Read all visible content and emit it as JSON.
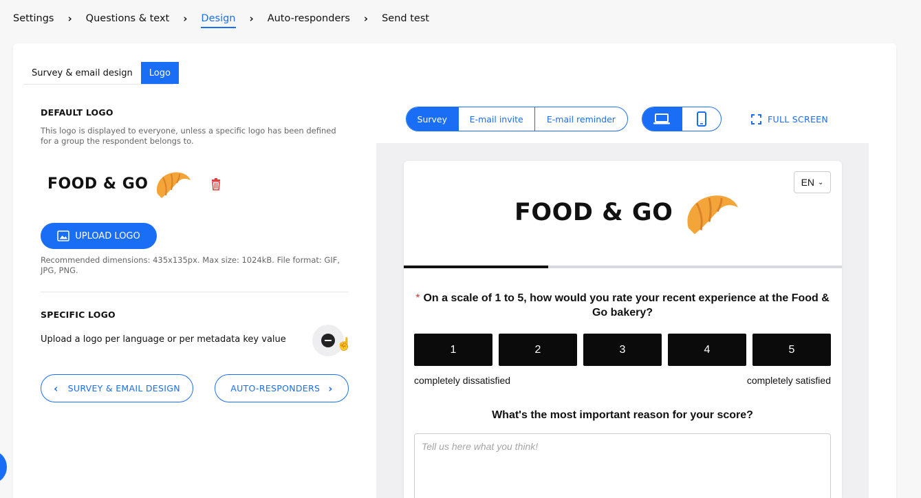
{
  "breadcrumb": {
    "steps": [
      "Settings",
      "Questions & text",
      "Design",
      "Auto-responders",
      "Send test"
    ],
    "active": "Design"
  },
  "subtabs": {
    "survey_email_design": "Survey & email design",
    "logo": "Logo"
  },
  "default_logo": {
    "heading": "DEFAULT LOGO",
    "description": "This logo is displayed to everyone, unless a specific logo has been defined for a group the respondent belongs to.",
    "logo_text": "FOOD & GO",
    "upload_label": "UPLOAD LOGO",
    "recommendation": "Recommended dimensions: 435x135px. Max size: 1024kB. File format: GIF, JPG, PNG."
  },
  "specific_logo": {
    "heading": "SPECIFIC LOGO",
    "description": "Upload a logo per language or per metadata key value"
  },
  "nav_buttons": {
    "back": "SURVEY & EMAIL DESIGN",
    "next": "AUTO-RESPONDERS"
  },
  "preview_toolbar": {
    "tabs": [
      "Survey",
      "E-mail invite",
      "E-mail reminder"
    ],
    "active_tab": "Survey",
    "devices": [
      "laptop-icon",
      "phone-icon"
    ],
    "active_device": "laptop-icon",
    "fullscreen": "FULL SCREEN"
  },
  "survey": {
    "language": "EN",
    "logo_text": "FOOD & GO",
    "progress": 0.33,
    "question1": {
      "required_mark": "*",
      "text": "On a scale of 1 to 5, how would you rate your recent experience at the Food & Go bakery?",
      "options": [
        "1",
        "2",
        "3",
        "4",
        "5"
      ],
      "low_label": "completely dissatisfied",
      "high_label": "completely satisfied"
    },
    "question2": {
      "text": "What's the most important reason for your score?",
      "placeholder": "Tell us here what you think!"
    }
  },
  "colors": {
    "accent": "#1a6ef5",
    "scale_button": "#0b0b0b",
    "delete": "#e03b3b"
  }
}
